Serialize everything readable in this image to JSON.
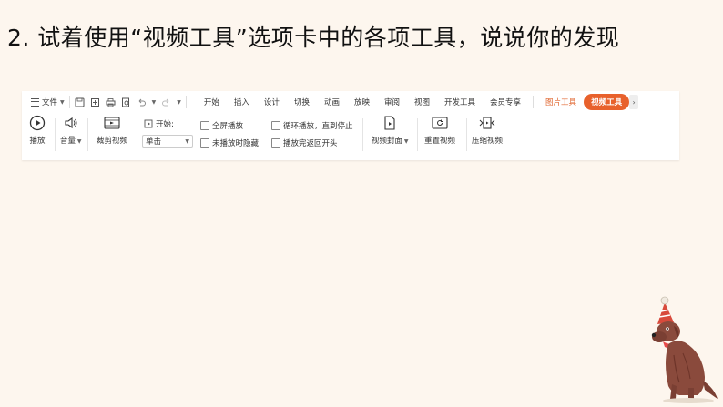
{
  "heading": "2. 试着使用“视频工具”选项卡中的各项工具，说说你的发现",
  "toolbar": {
    "file_label": "文件",
    "tabs": [
      "开始",
      "插入",
      "设计",
      "切换",
      "动画",
      "放映",
      "审阅",
      "视图",
      "开发工具",
      "会员专享"
    ],
    "picture_tools_tab": "图片工具",
    "video_tools_tab": "视频工具",
    "more_arrow": "›"
  },
  "commands": {
    "play": "播放",
    "volume": "音量",
    "trim_video": "裁剪视频",
    "start_label": "开始:",
    "start_value": "单击",
    "fullscreen": "全屏播放",
    "hide_when_not_playing": "未播放时隐藏",
    "loop": "循环播放，直到停止",
    "rewind_after_play": "播放完返回开头",
    "video_cover": "视频封面",
    "reset_video": "重置视频",
    "compress_video": "压缩视频"
  },
  "colors": {
    "accent": "#e8612c",
    "background": "#fdf6ee"
  }
}
